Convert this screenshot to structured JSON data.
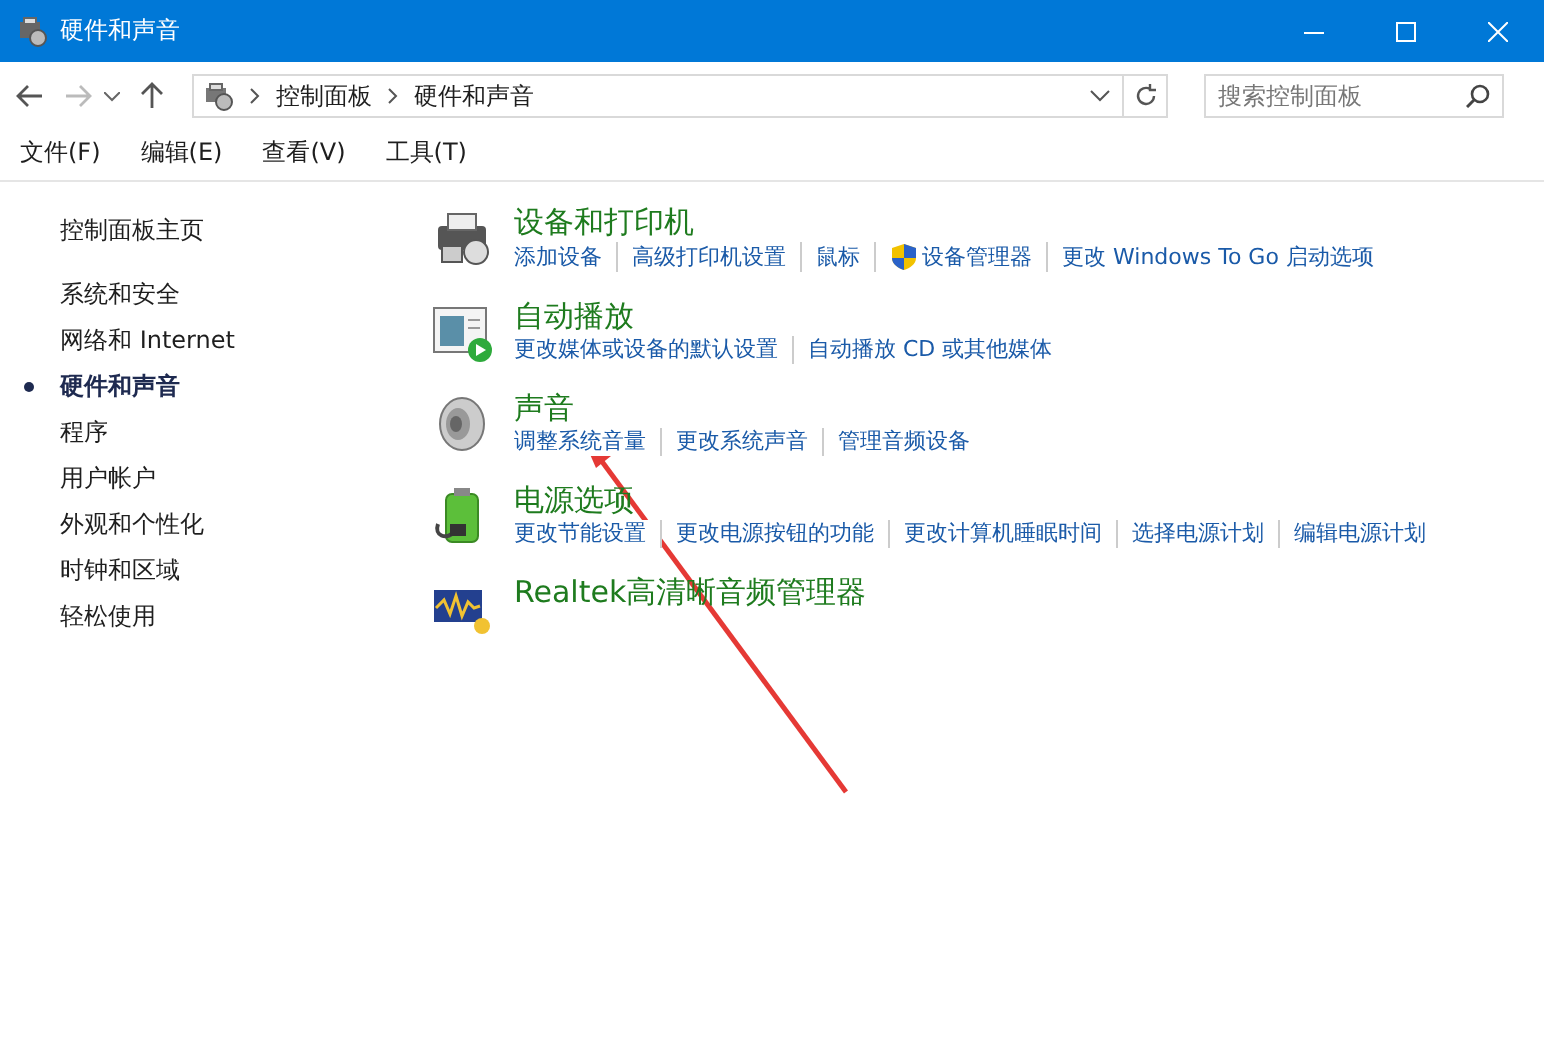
{
  "window": {
    "title": "硬件和声音"
  },
  "address_bar": {
    "path": [
      "控制面板",
      "硬件和声音"
    ]
  },
  "search": {
    "placeholder": "搜索控制面板"
  },
  "menu": [
    "文件(F)",
    "编辑(E)",
    "查看(V)",
    "工具(T)"
  ],
  "sidebar": {
    "home": "控制面板主页",
    "items": [
      {
        "label": "系统和安全",
        "selected": false
      },
      {
        "label": "网络和 Internet",
        "selected": false
      },
      {
        "label": "硬件和声音",
        "selected": true
      },
      {
        "label": "程序",
        "selected": false
      },
      {
        "label": "用户帐户",
        "selected": false
      },
      {
        "label": "外观和个性化",
        "selected": false
      },
      {
        "label": "时钟和区域",
        "selected": false
      },
      {
        "label": "轻松使用",
        "selected": false
      }
    ]
  },
  "categories": [
    {
      "kind": "printer",
      "title": "设备和打印机",
      "links": [
        {
          "label": "添加设备",
          "shield": false
        },
        {
          "label": "高级打印机设置",
          "shield": false
        },
        {
          "label": "鼠标",
          "shield": false
        },
        {
          "label": "设备管理器",
          "shield": true
        },
        {
          "label": "更改 Windows To Go 启动选项",
          "shield": false
        }
      ]
    },
    {
      "kind": "autoplay",
      "title": "自动播放",
      "links": [
        {
          "label": "更改媒体或设备的默认设置",
          "shield": false
        },
        {
          "label": "自动播放 CD 或其他媒体",
          "shield": false
        }
      ]
    },
    {
      "kind": "speaker",
      "title": "声音",
      "links": [
        {
          "label": "调整系统音量",
          "shield": false
        },
        {
          "label": "更改系统声音",
          "shield": false
        },
        {
          "label": "管理音频设备",
          "shield": false
        }
      ]
    },
    {
      "kind": "battery",
      "title": "电源选项",
      "links": [
        {
          "label": "更改节能设置",
          "shield": false
        },
        {
          "label": "更改电源按钮的功能",
          "shield": false
        },
        {
          "label": "更改计算机睡眠时间",
          "shield": false
        },
        {
          "label": "选择电源计划",
          "shield": false
        },
        {
          "label": "编辑电源计划",
          "shield": false
        }
      ]
    },
    {
      "kind": "audio",
      "title": "Realtek高清晰音频管理器"
    }
  ]
}
